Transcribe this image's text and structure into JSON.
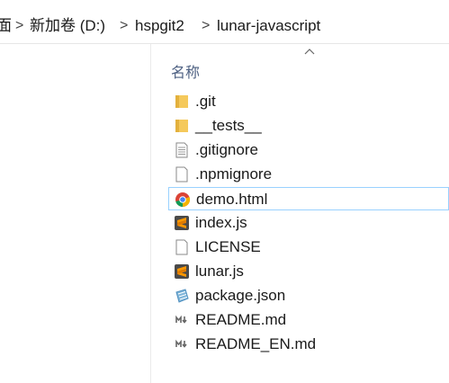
{
  "breadcrumb": {
    "items": [
      {
        "label": "面"
      },
      {
        "label": "新加卷 (D:)"
      },
      {
        "label": "hspgit2"
      },
      {
        "label": "lunar-javascript"
      }
    ],
    "separator": ">"
  },
  "list": {
    "column_name": "名称",
    "sort": "ascending",
    "selected_index": 3,
    "files": [
      {
        "name": ".git",
        "icon": "folder-icon"
      },
      {
        "name": "__tests__",
        "icon": "folder-icon"
      },
      {
        "name": ".gitignore",
        "icon": "text-file-icon"
      },
      {
        "name": ".npmignore",
        "icon": "blank-file-icon"
      },
      {
        "name": "demo.html",
        "icon": "chrome-icon"
      },
      {
        "name": "index.js",
        "icon": "sublime-icon"
      },
      {
        "name": "LICENSE",
        "icon": "blank-file-icon"
      },
      {
        "name": "lunar.js",
        "icon": "sublime-icon"
      },
      {
        "name": "package.json",
        "icon": "json-file-icon"
      },
      {
        "name": "README.md",
        "icon": "markdown-icon"
      },
      {
        "name": "README_EN.md",
        "icon": "markdown-icon"
      }
    ]
  },
  "colors": {
    "selection_border": "#99d1ff",
    "header_text": "#4d6082",
    "folder": "#f5c95b"
  }
}
